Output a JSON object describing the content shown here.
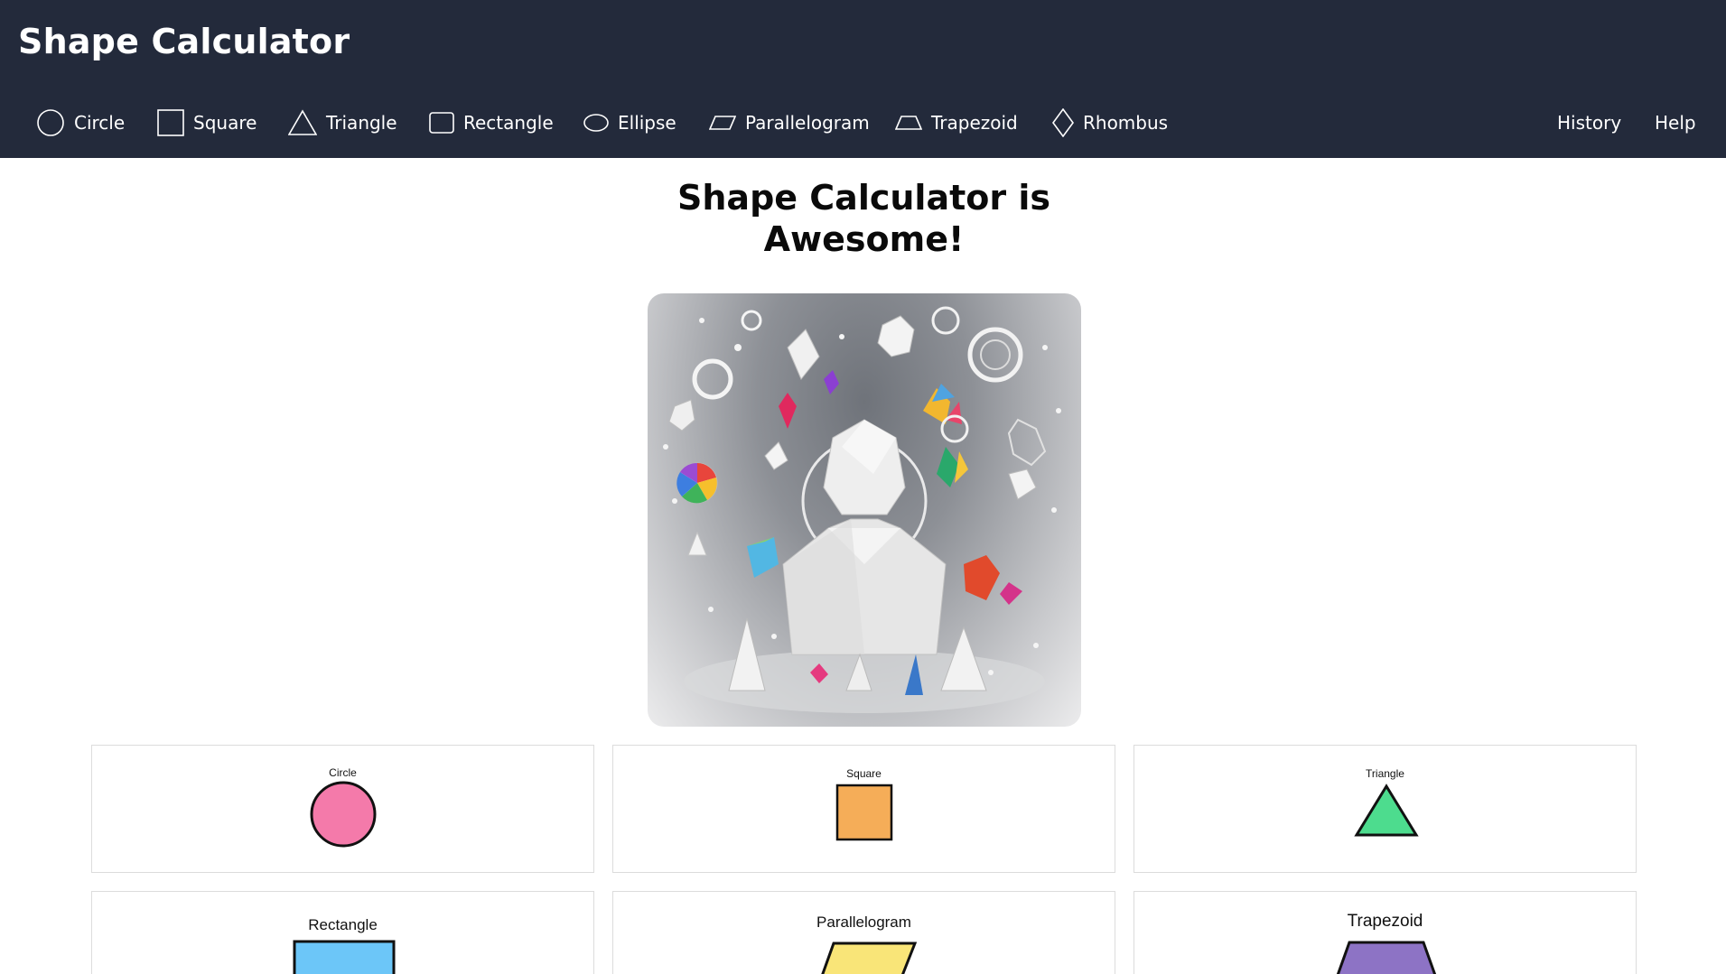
{
  "app": {
    "title": "Shape Calculator"
  },
  "nav": {
    "items": [
      {
        "label": "Circle",
        "icon": "circle-icon"
      },
      {
        "label": "Square",
        "icon": "square-icon"
      },
      {
        "label": "Triangle",
        "icon": "triangle-icon"
      },
      {
        "label": "Rectangle",
        "icon": "rectangle-icon"
      },
      {
        "label": "Ellipse",
        "icon": "ellipse-icon"
      },
      {
        "label": "Parallelogram",
        "icon": "parallelogram-icon"
      },
      {
        "label": "Trapezoid",
        "icon": "trapezoid-icon"
      },
      {
        "label": "Rhombus",
        "icon": "rhombus-icon"
      }
    ],
    "right": [
      {
        "label": "History"
      },
      {
        "label": "Help"
      }
    ]
  },
  "hero": {
    "title_line1": "Shape Calculator is",
    "title_line2": "Awesome!"
  },
  "cards": [
    {
      "label": "Circle",
      "color": "#f47aaa"
    },
    {
      "label": "Square",
      "color": "#f5ad58"
    },
    {
      "label": "Triangle",
      "color": "#4ddc8e"
    },
    {
      "label": "Rectangle",
      "color": "#6cc6f8"
    },
    {
      "label": "Parallelogram",
      "color": "#f9e578"
    },
    {
      "label": "Trapezoid",
      "color": "#8d73c5"
    }
  ],
  "colors": {
    "header_bg": "#232a3b",
    "page_bg": "#ffffff"
  }
}
